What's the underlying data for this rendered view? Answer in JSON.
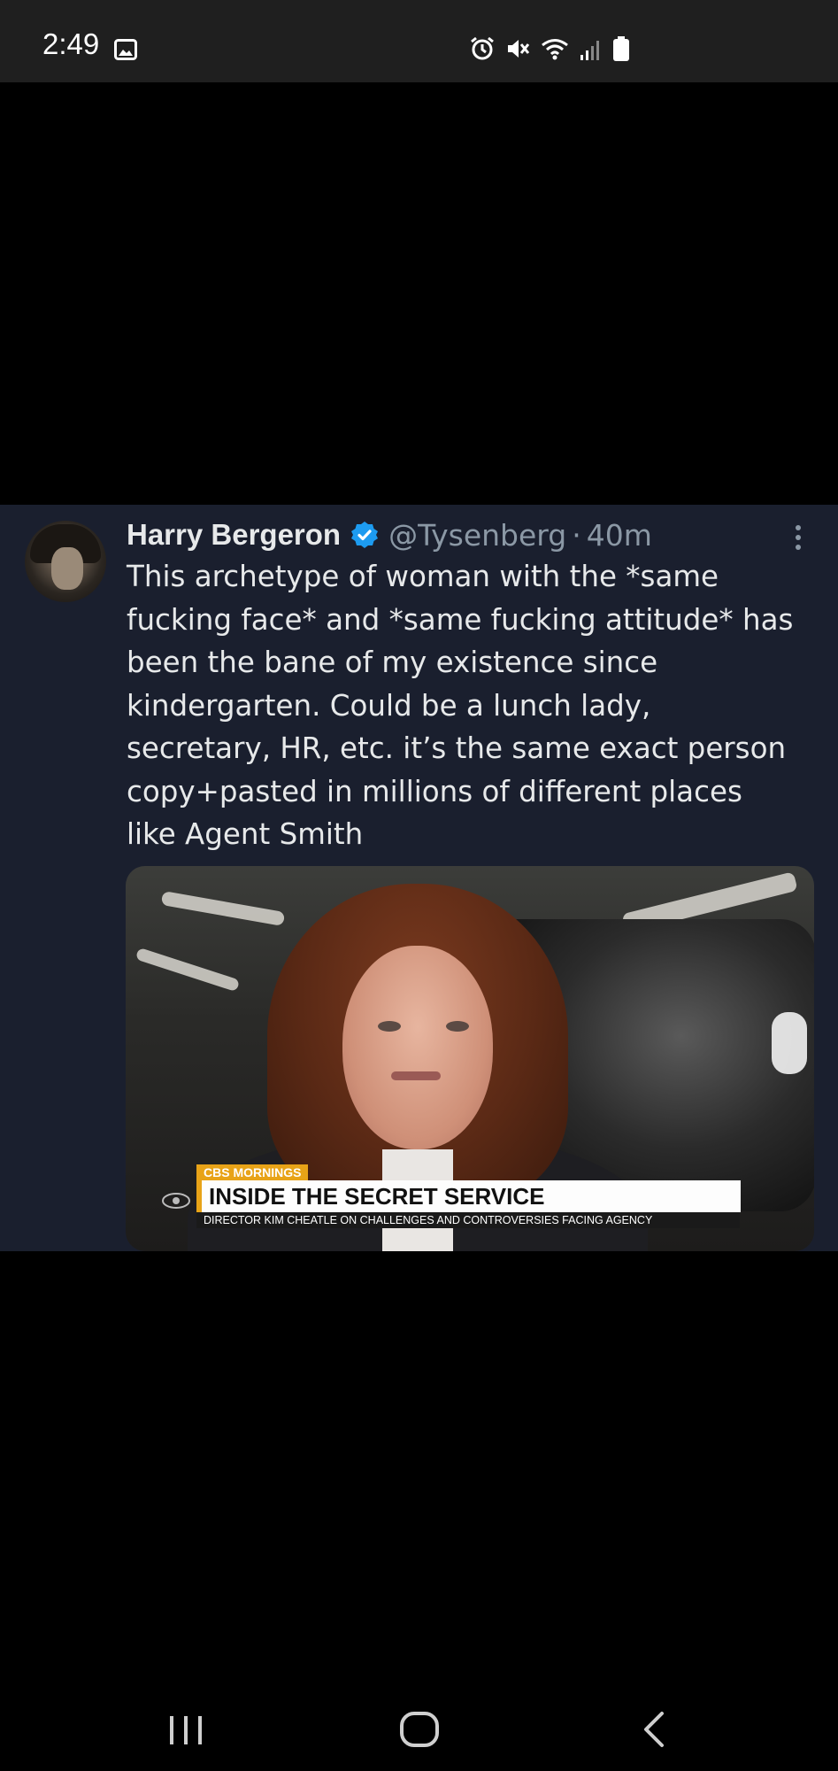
{
  "status_bar": {
    "time": "2:49",
    "left_icons": [
      "gallery-icon"
    ],
    "right_icons": [
      "alarm-icon",
      "mute-icon",
      "wifi-icon",
      "signal-icon",
      "battery-icon"
    ]
  },
  "tweet": {
    "author_name": "Harry Bergeron",
    "verified": true,
    "handle": "@Tysenberg",
    "separator": "·",
    "time": "40m",
    "text": "This archetype of woman with the *same\nfucking face* and *same fucking attitude* has\nbeen the bane of my existence since\nkindergarten. Could be a lunch lady,\nsecretary, HR, etc. it’s the same exact person\ncopy+pasted in millions of different places\nlike Agent Smith",
    "media": {
      "brand": "CBS MORNINGS",
      "headline": "INSIDE THE SECRET SERVICE",
      "subheadline": "DIRECTOR KIM CHEATLE ON CHALLENGES AND CONTROVERSIES FACING AGENCY"
    }
  },
  "nav_bar": {
    "buttons": [
      "recents-icon",
      "home-icon",
      "back-icon"
    ]
  },
  "colors": {
    "tweet_bg": "#1a1f2e",
    "verified_blue": "#1d9bf0",
    "muted_text": "#8b98a5",
    "cbs_accent": "#e8a317"
  }
}
